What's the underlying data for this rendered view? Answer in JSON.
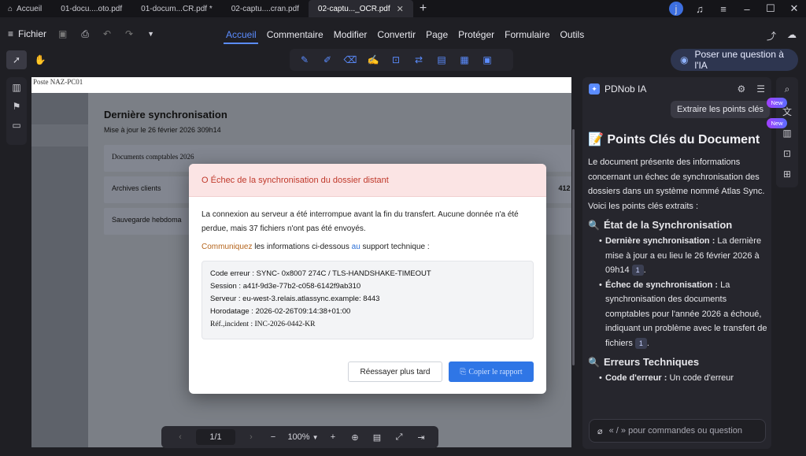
{
  "tabs": [
    {
      "label": "Accueil",
      "active": false
    },
    {
      "label": "01-docu....oto.pdf",
      "active": false
    },
    {
      "label": "01-docum...CR.pdf *",
      "active": false
    },
    {
      "label": "02-captu....cran.pdf",
      "active": false
    },
    {
      "label": "02-captu..._OCR.pdf",
      "active": true
    }
  ],
  "user_initial": "j",
  "menubar": {
    "fichier": "Fichier",
    "items": [
      "Accueil",
      "Commentaire",
      "Modifier",
      "Convertir",
      "Page",
      "Protéger",
      "Formulaire",
      "Outils"
    ],
    "active_index": 0
  },
  "ask_ai": "Poser une question à l'IA",
  "document": {
    "top_strip": "Poste NAZ-PC01",
    "title": "Dernière synchronisation",
    "subtitle": "Mise à jour le 26 février 2026 309h14",
    "rows": [
      {
        "label": "Documents comptables 2026",
        "amount": ""
      },
      {
        "label": "Archives clients",
        "amount": "412 f"
      },
      {
        "label": "Sauvegarde hebdoma",
        "amount": ""
      }
    ]
  },
  "modal": {
    "title": "O Échec de la synchronisation du dossier distant",
    "message": "La connexion au serveur a été interrompue avant la fin du transfert. Aucune donnée n'a été perdue, mais 37 fichiers n'ont pas été envoyés.",
    "contact_prefix": "Communiquez",
    "contact_middle": " les informations ci-dessous ",
    "contact_au": "au",
    "contact_suffix": " support technique :",
    "details": [
      "Code erreur : SYNC- 0x8007 274C / TLS-HANDSHAKE-TIMEOUT",
      "Session : a41f-9d3e-77b2-c058-6142f9ab310",
      "Serveur : eu-west-3.relais.atlassync.example: 8443",
      "Horodatage : 2026-02-26T09:14:38+01:00",
      "Réf.,incident : INC-2026-0442-KR"
    ],
    "retry_label": "Réessayer plus tard",
    "copy_label": "Copier le rapport"
  },
  "bottombar": {
    "page": "1/1",
    "zoom": "100%"
  },
  "ai": {
    "header": "PDNob IA",
    "chip": "Extraire les points clés",
    "badge": "New",
    "title": "Points Clés du Document",
    "intro": "Le document présente des informations concernant un échec de synchronisation des dossiers dans un système nommé Atlas Sync. Voici les points clés extraits :",
    "section1": "État de la Synchronisation",
    "s1_items": [
      {
        "bold": "Dernière synchronisation :",
        "text": " La dernière mise à jour a eu lieu le 26 février 2026 à 09h14",
        "cite": "1"
      },
      {
        "bold": "Échec de synchronisation :",
        "text": " La synchronisation des documents comptables pour l'année 2026 a échoué, indiquant un problème avec le transfert de fichiers",
        "cite": "1"
      }
    ],
    "section2": "Erreurs Techniques",
    "s2_item": {
      "bold": "Code d'erreur :",
      "text": " Un code d'erreur"
    },
    "input_placeholder": "« / » pour commandes ou question"
  }
}
